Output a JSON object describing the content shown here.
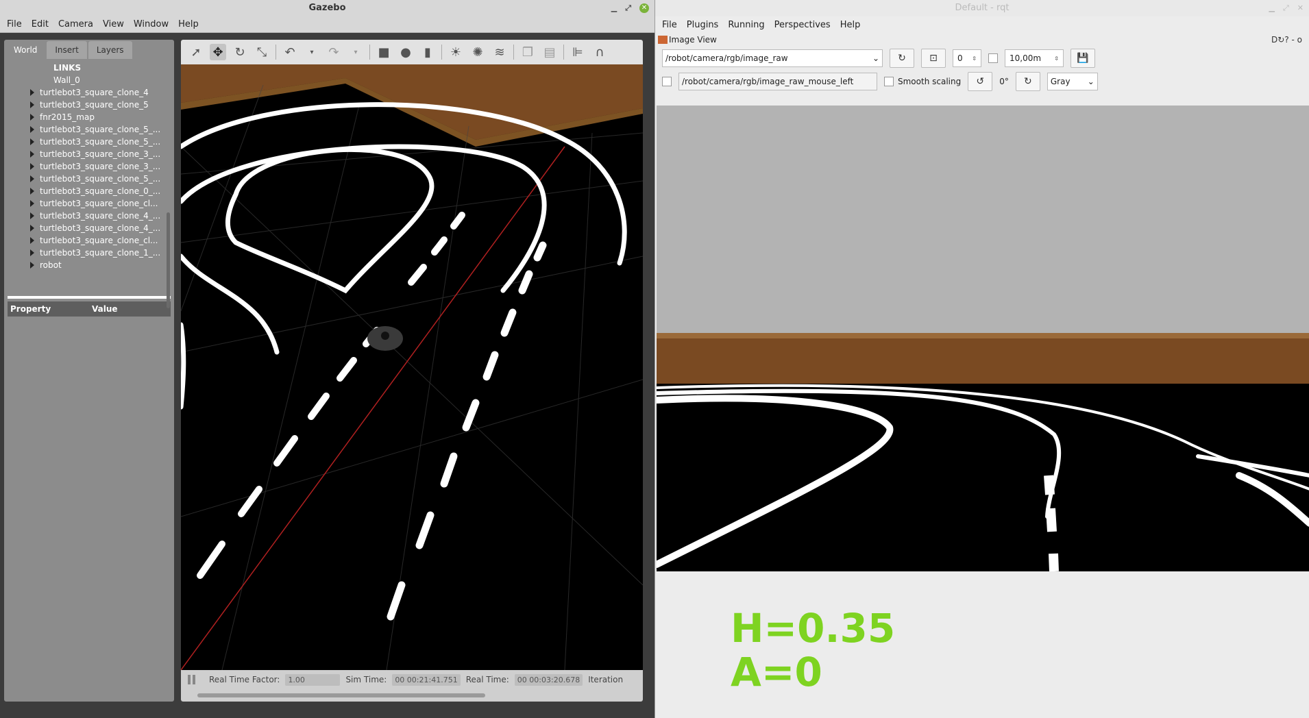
{
  "gazebo": {
    "title": "Gazebo",
    "menu": [
      "File",
      "Edit",
      "Camera",
      "View",
      "Window",
      "Help"
    ],
    "tabs": [
      "World",
      "Insert",
      "Layers"
    ],
    "tree": {
      "header": "LINKS",
      "first_leaf": "Wall_0",
      "nodes": [
        "turtlebot3_square_clone_4",
        "turtlebot3_square_clone_5",
        "fnr2015_map",
        "turtlebot3_square_clone_5_...",
        "turtlebot3_square_clone_5_...",
        "turtlebot3_square_clone_3_...",
        "turtlebot3_square_clone_3_...",
        "turtlebot3_square_clone_5_...",
        "turtlebot3_square_clone_0_...",
        "turtlebot3_square_clone_cl...",
        "turtlebot3_square_clone_4_...",
        "turtlebot3_square_clone_4_...",
        "turtlebot3_square_clone_cl...",
        "turtlebot3_square_clone_1_...",
        "robot"
      ]
    },
    "properties": {
      "col1": "Property",
      "col2": "Value"
    },
    "status": {
      "rtf_label": "Real Time Factor:",
      "rtf_value": "1.00",
      "sim_label": "Sim Time:",
      "sim_value": "00 00:21:41.751",
      "real_label": "Real Time:",
      "real_value": "00 00:03:20.678",
      "iter_label": "Iteration"
    }
  },
  "rqt": {
    "title": "Default - rqt",
    "menu": [
      "File",
      "Plugins",
      "Running",
      "Perspectives",
      "Help"
    ],
    "plugin_title": "Image View",
    "plugin_controls": "D↻? - o",
    "topic": "/robot/camera/rgb/image_raw",
    "spin_value": "0",
    "distance": "10,00m",
    "mouse_topic": "/robot/camera/rgb/image_raw_mouse_left",
    "smooth_label": "Smooth scaling",
    "rotation": "0°",
    "color_mode": "Gray",
    "overlay_h": "H=0.35",
    "overlay_a": "A=0"
  },
  "colors": {
    "overlay_green": "#7ed321",
    "floor": "#000000",
    "wall": "#7a4a22"
  }
}
